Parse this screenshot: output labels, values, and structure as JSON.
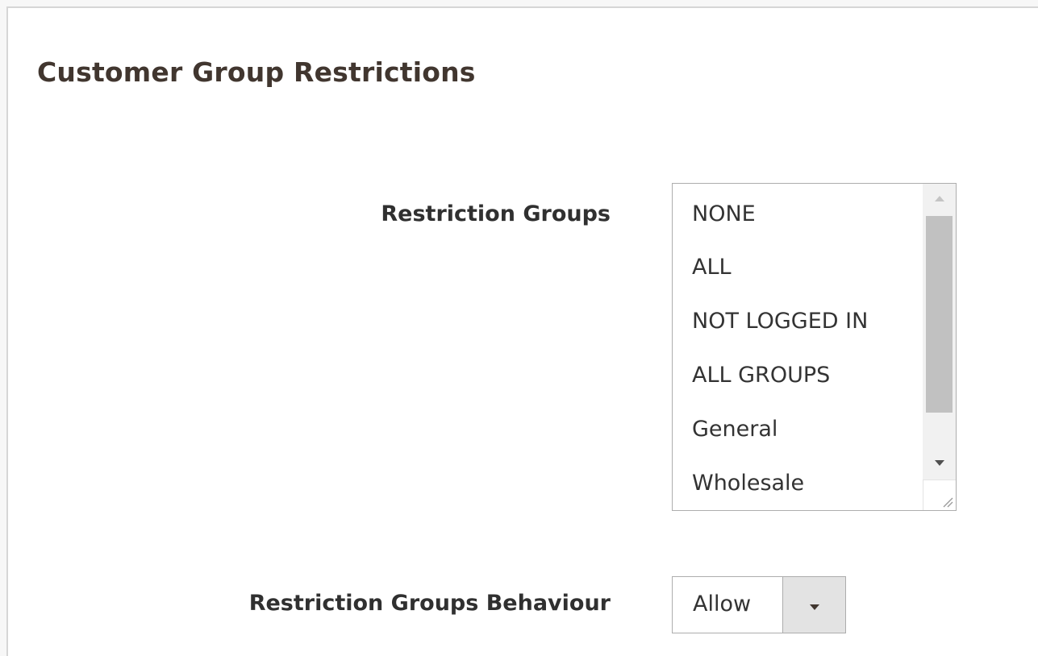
{
  "section": {
    "title": "Customer Group Restrictions"
  },
  "restriction_groups": {
    "label": "Restriction Groups",
    "options": [
      "NONE",
      "ALL",
      "NOT LOGGED IN",
      "ALL GROUPS",
      "General",
      "Wholesale"
    ]
  },
  "restriction_behaviour": {
    "label": "Restriction Groups Behaviour",
    "selected_value": "Allow"
  },
  "icons": {
    "scroll_up": "triangle-up-icon",
    "scroll_down": "triangle-down-icon",
    "resize": "resize-grip-icon",
    "dropdown": "chevron-down-icon"
  }
}
